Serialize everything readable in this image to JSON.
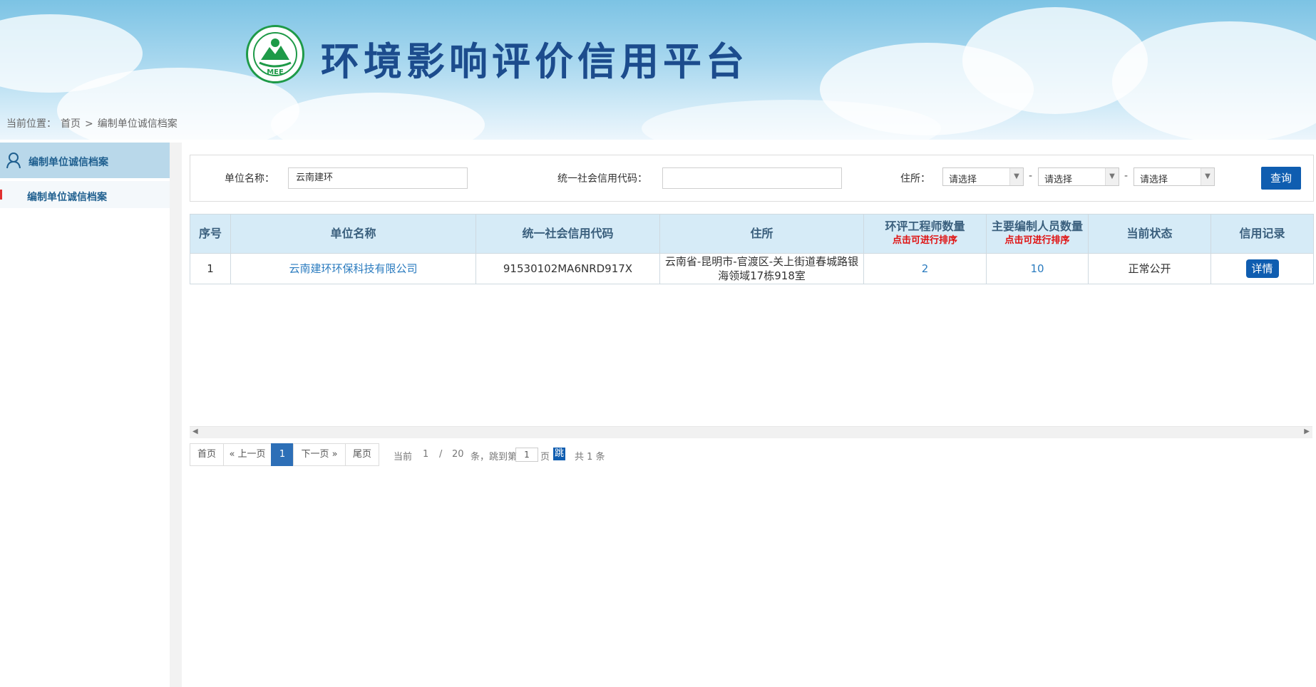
{
  "header": {
    "logo_text": "MEE",
    "title": "环境影响评价信用平台"
  },
  "breadcrumb": {
    "prefix": "当前位置：",
    "home": "首页",
    "sep": ">",
    "current": "编制单位诚信档案"
  },
  "sidebar": {
    "head_label": "编制单位诚信档案",
    "items": [
      {
        "label": "编制单位诚信档案"
      }
    ]
  },
  "search": {
    "name_label": "单位名称：",
    "name_value": "云南建环",
    "code_label": "统一社会信用代码：",
    "code_value": "",
    "address_label": "住所：",
    "select1": "请选择",
    "select2": "请选择",
    "select3": "请选择",
    "dash": "-",
    "query_label": "查询"
  },
  "table": {
    "headers": {
      "no": "序号",
      "name": "单位名称",
      "code": "统一社会信用代码",
      "address": "住所",
      "engineers": "环评工程师数量",
      "engineers_sub": "点击可进行排序",
      "staff": "主要编制人员数量",
      "staff_sub": "点击可进行排序",
      "status": "当前状态",
      "credit": "信用记录"
    },
    "rows": [
      {
        "no": "1",
        "name": "云南建环环保科技有限公司",
        "code": "91530102MA6NRD917X",
        "address": "云南省-昆明市-官渡区-关上街道春城路银海领域17栋918室",
        "engineers": "2",
        "staff": "10",
        "status": "正常公开",
        "credit": "详情"
      }
    ]
  },
  "pager": {
    "first": "首页",
    "prev": "« 上一页",
    "current_page": "1",
    "next": "下一页 »",
    "last": "尾页",
    "info_current": "当前",
    "info_page": "1",
    "info_slash": "/",
    "info_per": "20",
    "info_unit": "条，跳到第",
    "jump_value": "1",
    "info_page_unit": "页",
    "jump_label": "跳转",
    "total": "共 1 条"
  }
}
